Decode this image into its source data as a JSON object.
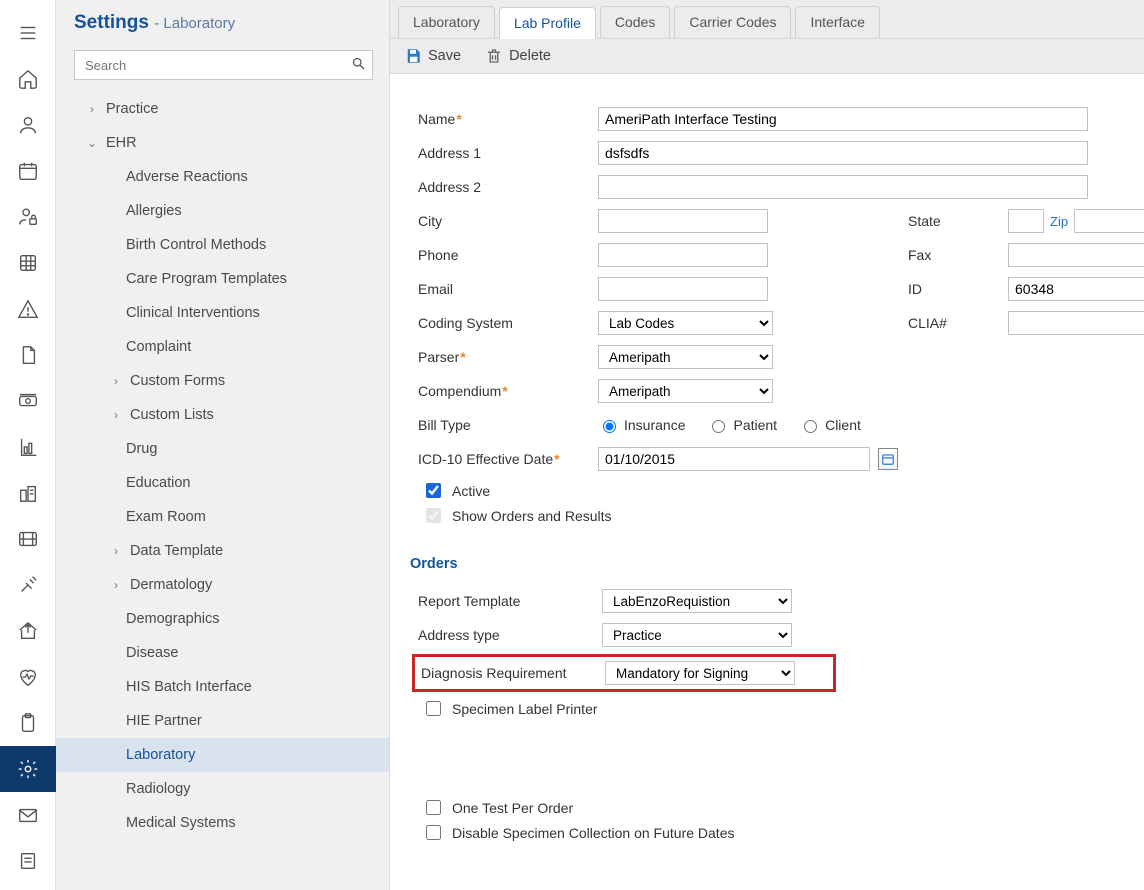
{
  "breadcrumb": {
    "main": "Settings",
    "sub": "- Laboratory"
  },
  "search": {
    "placeholder": "Search"
  },
  "sidebar": {
    "top": [
      {
        "label": "Practice",
        "expandable": true
      },
      {
        "label": "EHR",
        "expandable": true,
        "expanded": true
      }
    ],
    "ehr_children": [
      {
        "label": "Adverse Reactions"
      },
      {
        "label": "Allergies"
      },
      {
        "label": "Birth Control Methods"
      },
      {
        "label": "Care Program Templates"
      },
      {
        "label": "Clinical Interventions"
      },
      {
        "label": "Complaint"
      },
      {
        "label": "Custom Forms",
        "expandable": true
      },
      {
        "label": "Custom Lists",
        "expandable": true
      },
      {
        "label": "Drug"
      },
      {
        "label": "Education"
      },
      {
        "label": "Exam Room"
      },
      {
        "label": "Data Template",
        "expandable": true
      },
      {
        "label": "Dermatology",
        "expandable": true
      },
      {
        "label": "Demographics"
      },
      {
        "label": "Disease"
      },
      {
        "label": "HIS Batch Interface"
      },
      {
        "label": "HIE Partner"
      },
      {
        "label": "Laboratory",
        "selected": true
      },
      {
        "label": "Radiology"
      },
      {
        "label": "Medical Systems"
      }
    ]
  },
  "tabs": [
    {
      "label": "Laboratory"
    },
    {
      "label": "Lab Profile",
      "active": true
    },
    {
      "label": "Codes"
    },
    {
      "label": "Carrier Codes"
    },
    {
      "label": "Interface"
    }
  ],
  "toolbar": {
    "save": "Save",
    "delete": "Delete"
  },
  "form": {
    "labels": {
      "name": "Name",
      "address1": "Address 1",
      "address2": "Address 2",
      "city": "City",
      "state": "State",
      "zip": "Zip",
      "phone": "Phone",
      "fax": "Fax",
      "email": "Email",
      "id": "ID",
      "coding_system": "Coding System",
      "clia": "CLIA#",
      "parser": "Parser",
      "compendium": "Compendium",
      "bill_type": "Bill Type",
      "icd10": "ICD-10 Effective Date",
      "active": "Active",
      "show_orders": "Show Orders and Results"
    },
    "values": {
      "name": "AmeriPath Interface Testing",
      "address1": "dsfsdfs",
      "address2": "",
      "city": "",
      "state": "",
      "zip1": "",
      "zip2": "",
      "phone": "",
      "fax": "",
      "email": "",
      "id": "60348",
      "clia": "",
      "coding_system": "Lab Codes",
      "parser": "Ameripath",
      "compendium": "Ameripath",
      "bill_type_options": {
        "insurance": "Insurance",
        "patient": "Patient",
        "client": "Client"
      },
      "bill_type_selected": "insurance",
      "icd10": "01/10/2015",
      "active": true,
      "show_orders": true
    }
  },
  "orders": {
    "heading": "Orders",
    "labels": {
      "report_template": "Report Template",
      "address_type": "Address type",
      "diagnosis_req": "Diagnosis Requirement",
      "specimen_printer": "Specimen Label Printer",
      "one_test": "One Test Per Order",
      "disable_future": "Disable Specimen Collection on Future Dates"
    },
    "values": {
      "report_template": "LabEnzoRequistion",
      "address_type": "Practice",
      "diagnosis_req": "Mandatory for Signing",
      "specimen_printer": false,
      "one_test": false,
      "disable_future": false
    }
  }
}
